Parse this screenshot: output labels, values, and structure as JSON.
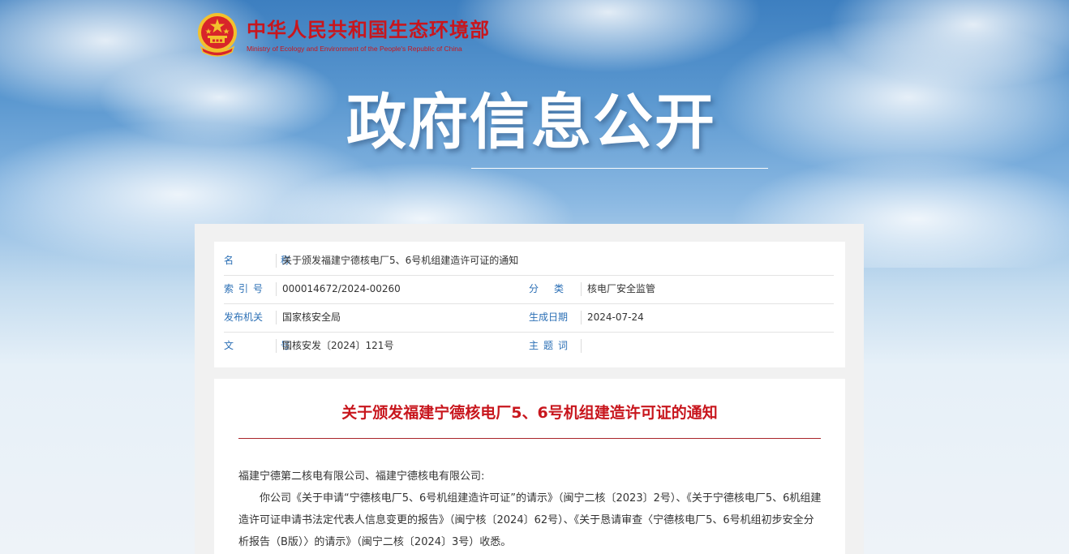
{
  "header": {
    "ministry_cn": "中华人民共和国生态环境部",
    "ministry_en": "Ministry of Ecology and Environment of the People's Republic of China",
    "emblem_icon": "national-emblem-icon"
  },
  "banner": {
    "title": "政府信息公开"
  },
  "meta": {
    "name_label": "名 称",
    "name_value": "关于颁发福建宁德核电厂5、6号机组建造许可证的通知",
    "index_label": "索引号",
    "index_value": "000014672/2024-00260",
    "category_label": "分类",
    "category_value": "核电厂安全监管",
    "issuer_label": "发布机关",
    "issuer_value": "国家核安全局",
    "date_label": "生成日期",
    "date_value": "2024-07-24",
    "docno_label": "文 号",
    "docno_value": "国核安发〔2024〕121号",
    "subject_label": "主题词",
    "subject_value": ""
  },
  "document": {
    "title": "关于颁发福建宁德核电厂5、6号机组建造许可证的通知",
    "salutation": "福建宁德第二核电有限公司、福建宁德核电有限公司:",
    "paragraph1": "你公司《关于申请“宁德核电厂5、6号机组建造许可证”的请示》（闽宁二核〔2023〕2号）、《关于宁德核电厂5、6机组建造许可证申请书法定代表人信息变更的报告》（闽宁核〔2024〕62号）、《关于恳请审查〈宁德核电厂5、6号机组初步安全分析报告（B版）〉的请示》（闽宁二核〔2024〕3号）收悉。"
  },
  "colors": {
    "brand_red": "#c8161d",
    "label_blue": "#2b6fb5"
  }
}
